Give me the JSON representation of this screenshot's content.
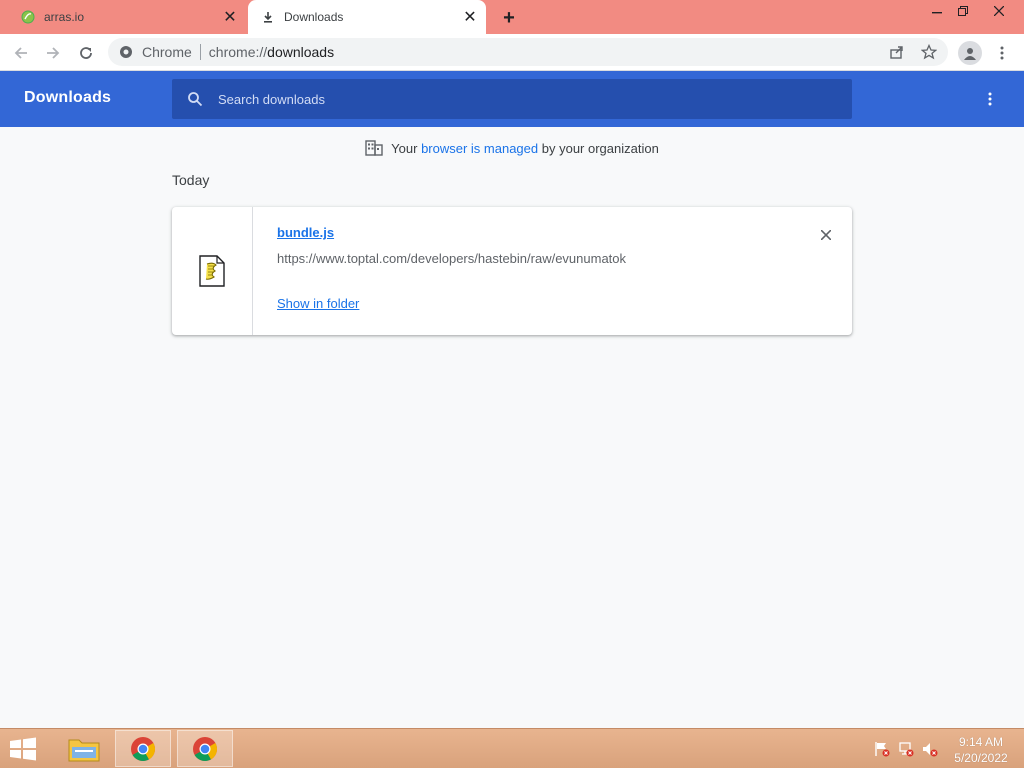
{
  "tabs": [
    {
      "title": "arras.io",
      "favicon": "arras-leaf-icon",
      "active": false
    },
    {
      "title": "Downloads",
      "favicon": "download-icon",
      "active": true
    }
  ],
  "omnibox": {
    "chip": "Chrome",
    "url_scheme": "chrome://",
    "url_rest": "downloads"
  },
  "page": {
    "title": "Downloads",
    "search_placeholder": "Search downloads",
    "managed": {
      "prefix": "Your",
      "link": "browser is managed",
      "suffix": "by your organization"
    },
    "date_header": "Today",
    "items": [
      {
        "filename": "bundle.js",
        "url": "https://www.toptal.com/developers/hastebin/raw/evunumatok",
        "action": "Show in folder"
      }
    ]
  },
  "taskbar": {
    "time": "9:14 AM",
    "date": "5/20/2022",
    "pinned": [
      "file-explorer-icon",
      "chrome-icon",
      "chrome-icon"
    ]
  },
  "colors": {
    "tabstrip": "#f28b82",
    "header": "#3367d6",
    "link": "#1a73e8"
  }
}
